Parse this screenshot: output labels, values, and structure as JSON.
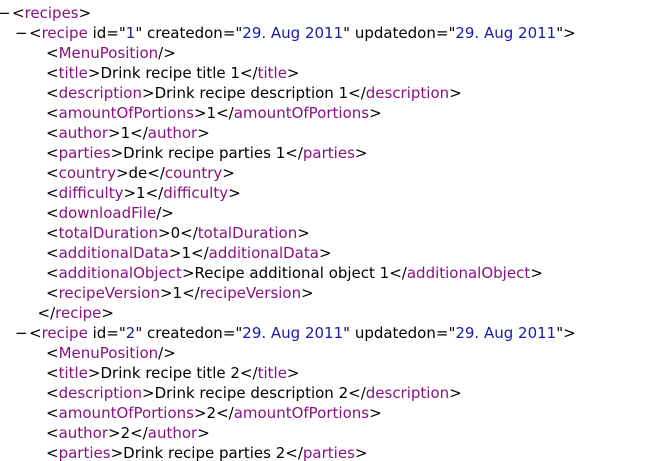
{
  "collapse_glyph": "−",
  "nodes": [
    {
      "indent": 0,
      "toggle": true,
      "parts": [
        [
          "p",
          "<"
        ],
        [
          "t",
          "recipes"
        ],
        [
          "p",
          ">"
        ]
      ]
    },
    {
      "indent": 1,
      "toggle": true,
      "parts": [
        [
          "p",
          "<"
        ],
        [
          "t",
          "recipe"
        ],
        [
          "p",
          " "
        ],
        [
          "a",
          "id"
        ],
        [
          "p",
          "=\""
        ],
        [
          "v",
          "1"
        ],
        [
          "p",
          "\" "
        ],
        [
          "a",
          "createdon"
        ],
        [
          "p",
          "=\""
        ],
        [
          "v",
          "29. Aug 2011"
        ],
        [
          "p",
          "\" "
        ],
        [
          "a",
          "updatedon"
        ],
        [
          "p",
          "=\""
        ],
        [
          "v",
          "29. Aug 2011"
        ],
        [
          "p",
          "\">"
        ]
      ]
    },
    {
      "indent": 2,
      "toggle": false,
      "parts": [
        [
          "p",
          "<"
        ],
        [
          "t",
          "MenuPosition"
        ],
        [
          "p",
          "/>"
        ]
      ]
    },
    {
      "indent": 2,
      "toggle": false,
      "parts": [
        [
          "p",
          "<"
        ],
        [
          "t",
          "title"
        ],
        [
          "p",
          ">"
        ],
        [
          "x",
          "Drink recipe title 1"
        ],
        [
          "p",
          "</"
        ],
        [
          "t",
          "title"
        ],
        [
          "p",
          ">"
        ]
      ]
    },
    {
      "indent": 2,
      "toggle": false,
      "parts": [
        [
          "p",
          "<"
        ],
        [
          "t",
          "description"
        ],
        [
          "p",
          ">"
        ],
        [
          "x",
          "Drink recipe description 1"
        ],
        [
          "p",
          "</"
        ],
        [
          "t",
          "description"
        ],
        [
          "p",
          ">"
        ]
      ]
    },
    {
      "indent": 2,
      "toggle": false,
      "parts": [
        [
          "p",
          "<"
        ],
        [
          "t",
          "amountOfPortions"
        ],
        [
          "p",
          ">"
        ],
        [
          "x",
          "1"
        ],
        [
          "p",
          "</"
        ],
        [
          "t",
          "amountOfPortions"
        ],
        [
          "p",
          ">"
        ]
      ]
    },
    {
      "indent": 2,
      "toggle": false,
      "parts": [
        [
          "p",
          "<"
        ],
        [
          "t",
          "author"
        ],
        [
          "p",
          ">"
        ],
        [
          "x",
          "1"
        ],
        [
          "p",
          "</"
        ],
        [
          "t",
          "author"
        ],
        [
          "p",
          ">"
        ]
      ]
    },
    {
      "indent": 2,
      "toggle": false,
      "parts": [
        [
          "p",
          "<"
        ],
        [
          "t",
          "parties"
        ],
        [
          "p",
          ">"
        ],
        [
          "x",
          "Drink recipe parties 1"
        ],
        [
          "p",
          "</"
        ],
        [
          "t",
          "parties"
        ],
        [
          "p",
          ">"
        ]
      ]
    },
    {
      "indent": 2,
      "toggle": false,
      "parts": [
        [
          "p",
          "<"
        ],
        [
          "t",
          "country"
        ],
        [
          "p",
          ">"
        ],
        [
          "x",
          "de"
        ],
        [
          "p",
          "</"
        ],
        [
          "t",
          "country"
        ],
        [
          "p",
          ">"
        ]
      ]
    },
    {
      "indent": 2,
      "toggle": false,
      "parts": [
        [
          "p",
          "<"
        ],
        [
          "t",
          "difficulty"
        ],
        [
          "p",
          ">"
        ],
        [
          "x",
          "1"
        ],
        [
          "p",
          "</"
        ],
        [
          "t",
          "difficulty"
        ],
        [
          "p",
          ">"
        ]
      ]
    },
    {
      "indent": 2,
      "toggle": false,
      "parts": [
        [
          "p",
          "<"
        ],
        [
          "t",
          "downloadFile"
        ],
        [
          "p",
          "/>"
        ]
      ]
    },
    {
      "indent": 2,
      "toggle": false,
      "parts": [
        [
          "p",
          "<"
        ],
        [
          "t",
          "totalDuration"
        ],
        [
          "p",
          ">"
        ],
        [
          "x",
          "0"
        ],
        [
          "p",
          "</"
        ],
        [
          "t",
          "totalDuration"
        ],
        [
          "p",
          ">"
        ]
      ]
    },
    {
      "indent": 2,
      "toggle": false,
      "parts": [
        [
          "p",
          "<"
        ],
        [
          "t",
          "additionalData"
        ],
        [
          "p",
          ">"
        ],
        [
          "x",
          "1"
        ],
        [
          "p",
          "</"
        ],
        [
          "t",
          "additionalData"
        ],
        [
          "p",
          ">"
        ]
      ]
    },
    {
      "indent": 2,
      "toggle": false,
      "parts": [
        [
          "p",
          "<"
        ],
        [
          "t",
          "additionalObject"
        ],
        [
          "p",
          ">"
        ],
        [
          "x",
          "Recipe additional object 1"
        ],
        [
          "p",
          "</"
        ],
        [
          "t",
          "additionalObject"
        ],
        [
          "p",
          ">"
        ]
      ]
    },
    {
      "indent": 2,
      "toggle": false,
      "parts": [
        [
          "p",
          "<"
        ],
        [
          "t",
          "recipeVersion"
        ],
        [
          "p",
          ">"
        ],
        [
          "x",
          "1"
        ],
        [
          "p",
          "</"
        ],
        [
          "t",
          "recipeVersion"
        ],
        [
          "p",
          ">"
        ]
      ]
    },
    {
      "indent": 1.5,
      "toggle": false,
      "parts": [
        [
          "p",
          "</"
        ],
        [
          "t",
          "recipe"
        ],
        [
          "p",
          ">"
        ]
      ]
    },
    {
      "indent": 1,
      "toggle": true,
      "parts": [
        [
          "p",
          "<"
        ],
        [
          "t",
          "recipe"
        ],
        [
          "p",
          " "
        ],
        [
          "a",
          "id"
        ],
        [
          "p",
          "=\""
        ],
        [
          "v",
          "2"
        ],
        [
          "p",
          "\" "
        ],
        [
          "a",
          "createdon"
        ],
        [
          "p",
          "=\""
        ],
        [
          "v",
          "29. Aug 2011"
        ],
        [
          "p",
          "\" "
        ],
        [
          "a",
          "updatedon"
        ],
        [
          "p",
          "=\""
        ],
        [
          "v",
          "29. Aug 2011"
        ],
        [
          "p",
          "\">"
        ]
      ]
    },
    {
      "indent": 2,
      "toggle": false,
      "parts": [
        [
          "p",
          "<"
        ],
        [
          "t",
          "MenuPosition"
        ],
        [
          "p",
          "/>"
        ]
      ]
    },
    {
      "indent": 2,
      "toggle": false,
      "parts": [
        [
          "p",
          "<"
        ],
        [
          "t",
          "title"
        ],
        [
          "p",
          ">"
        ],
        [
          "x",
          "Drink recipe title 2"
        ],
        [
          "p",
          "</"
        ],
        [
          "t",
          "title"
        ],
        [
          "p",
          ">"
        ]
      ]
    },
    {
      "indent": 2,
      "toggle": false,
      "parts": [
        [
          "p",
          "<"
        ],
        [
          "t",
          "description"
        ],
        [
          "p",
          ">"
        ],
        [
          "x",
          "Drink recipe description 2"
        ],
        [
          "p",
          "</"
        ],
        [
          "t",
          "description"
        ],
        [
          "p",
          ">"
        ]
      ]
    },
    {
      "indent": 2,
      "toggle": false,
      "parts": [
        [
          "p",
          "<"
        ],
        [
          "t",
          "amountOfPortions"
        ],
        [
          "p",
          ">"
        ],
        [
          "x",
          "2"
        ],
        [
          "p",
          "</"
        ],
        [
          "t",
          "amountOfPortions"
        ],
        [
          "p",
          ">"
        ]
      ]
    },
    {
      "indent": 2,
      "toggle": false,
      "parts": [
        [
          "p",
          "<"
        ],
        [
          "t",
          "author"
        ],
        [
          "p",
          ">"
        ],
        [
          "x",
          "2"
        ],
        [
          "p",
          "</"
        ],
        [
          "t",
          "author"
        ],
        [
          "p",
          ">"
        ]
      ]
    },
    {
      "indent": 2,
      "toggle": false,
      "parts": [
        [
          "p",
          "<"
        ],
        [
          "t",
          "parties"
        ],
        [
          "p",
          ">"
        ],
        [
          "x",
          "Drink recipe parties 2"
        ],
        [
          "p",
          "</"
        ],
        [
          "t",
          "parties"
        ],
        [
          "p",
          ">"
        ]
      ]
    }
  ]
}
